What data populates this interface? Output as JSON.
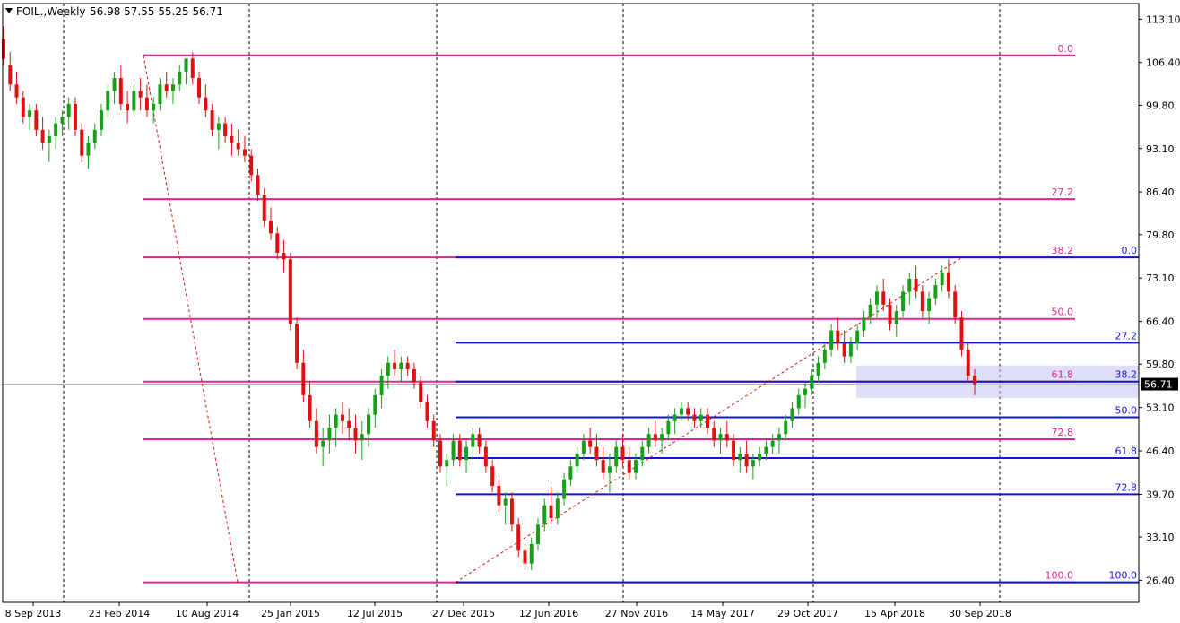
{
  "header": {
    "symbol_timeframe": "FOIL.,Weekly",
    "ohlc": "56.98 57.55 55.25 56.71",
    "collapse_glyph": "triangle-down-icon"
  },
  "colors": {
    "pink": "#e8228c",
    "blue": "#1414d2",
    "bull": "#16a016",
    "bear": "#e01010",
    "grid": "#000000",
    "price_tag_bg": "#000000",
    "zone": "#c8c8f0"
  },
  "chart_data": {
    "type": "candlestick",
    "title": "FOIL.,Weekly",
    "ylim": [
      23.0,
      115.5
    ],
    "y_ticks": [
      "113.10",
      "106.40",
      "99.80",
      "93.10",
      "86.40",
      "79.80",
      "73.10",
      "66.40",
      "59.80",
      "53.10",
      "46.40",
      "39.70",
      "33.10",
      "26.40"
    ],
    "x_ticks": [
      "8 Sep 2013",
      "23 Feb 2014",
      "10 Aug 2014",
      "25 Jan 2015",
      "12 Jul 2015",
      "27 Dec 2015",
      "12 Jun 2016",
      "27 Nov 2016",
      "14 May 2017",
      "29 Oct 2017",
      "15 Apr 2018",
      "30 Sep 2018"
    ],
    "current_price": "56.71",
    "series": [
      {
        "values": [
          [
            0,
            110,
            112,
            106,
            107
          ],
          [
            1,
            106,
            108,
            102,
            103
          ],
          [
            2,
            103,
            105,
            100,
            101
          ],
          [
            3,
            101,
            102,
            97,
            98
          ],
          [
            4,
            98,
            100,
            96,
            99
          ],
          [
            5,
            99,
            100,
            95,
            96
          ],
          [
            6,
            96,
            98,
            93,
            94
          ],
          [
            7,
            94,
            96,
            91,
            95
          ],
          [
            8,
            95,
            98,
            93,
            97
          ],
          [
            9,
            97,
            99,
            95,
            98
          ],
          [
            10,
            98,
            101,
            96,
            100
          ],
          [
            11,
            100,
            101,
            95,
            96
          ],
          [
            12,
            96,
            97,
            91,
            92
          ],
          [
            13,
            92,
            95,
            90,
            94
          ],
          [
            14,
            94,
            97,
            93,
            96
          ],
          [
            15,
            96,
            100,
            95,
            99
          ],
          [
            16,
            99,
            103,
            98,
            102
          ],
          [
            17,
            102,
            105,
            100,
            104
          ],
          [
            18,
            104,
            106,
            99,
            100
          ],
          [
            19,
            100,
            102,
            97,
            99
          ],
          [
            20,
            99,
            103,
            98,
            102
          ],
          [
            21,
            102,
            104,
            99,
            101
          ],
          [
            22,
            101,
            103,
            98,
            99
          ],
          [
            23,
            99,
            101,
            97,
            100
          ],
          [
            24,
            100,
            104,
            99,
            103
          ],
          [
            25,
            103,
            105,
            101,
            102
          ],
          [
            26,
            102,
            104,
            100,
            103
          ],
          [
            27,
            103,
            106,
            102,
            105
          ],
          [
            28,
            105,
            107,
            103,
            107
          ],
          [
            29,
            107,
            108,
            103,
            104
          ],
          [
            30,
            104,
            105,
            100,
            101
          ],
          [
            31,
            101,
            103,
            98,
            99
          ],
          [
            32,
            99,
            100,
            95,
            96
          ],
          [
            33,
            96,
            98,
            93,
            97
          ],
          [
            34,
            97,
            98,
            94,
            95
          ],
          [
            35,
            95,
            97,
            92,
            94
          ],
          [
            36,
            94,
            96,
            92,
            93
          ],
          [
            37,
            93,
            95,
            91,
            92
          ],
          [
            38,
            92,
            93,
            88,
            89
          ],
          [
            39,
            89,
            90,
            85,
            86
          ],
          [
            40,
            86,
            87,
            81,
            82
          ],
          [
            41,
            82,
            84,
            79,
            80
          ],
          [
            42,
            80,
            81,
            76,
            77
          ],
          [
            43,
            77,
            79,
            74,
            76
          ],
          [
            44,
            76,
            77,
            65,
            66
          ],
          [
            45,
            66,
            67,
            59,
            60
          ],
          [
            46,
            60,
            62,
            54,
            55
          ],
          [
            47,
            55,
            57,
            50,
            51
          ],
          [
            48,
            51,
            53,
            46,
            47
          ],
          [
            49,
            47,
            50,
            44,
            48
          ],
          [
            50,
            48,
            52,
            46,
            50
          ],
          [
            51,
            50,
            53,
            47,
            52
          ],
          [
            52,
            52,
            54,
            49,
            51
          ],
          [
            53,
            51,
            53,
            48,
            50
          ],
          [
            54,
            50,
            52,
            46,
            48
          ],
          [
            55,
            48,
            51,
            45,
            49
          ],
          [
            56,
            49,
            53,
            47,
            52
          ],
          [
            57,
            52,
            56,
            50,
            55
          ],
          [
            58,
            55,
            59,
            53,
            58
          ],
          [
            59,
            58,
            61,
            56,
            60
          ],
          [
            60,
            60,
            62,
            58,
            59
          ],
          [
            61,
            59,
            61,
            57,
            60
          ],
          [
            62,
            60,
            61,
            58,
            59
          ],
          [
            63,
            59,
            60,
            56,
            57
          ],
          [
            64,
            57,
            58,
            53,
            54
          ],
          [
            65,
            54,
            55,
            50,
            51
          ],
          [
            66,
            51,
            52,
            47,
            48
          ],
          [
            67,
            48,
            49,
            43,
            44
          ],
          [
            68,
            44,
            46,
            41,
            45
          ],
          [
            69,
            45,
            49,
            44,
            48
          ],
          [
            70,
            48,
            49,
            44,
            45
          ],
          [
            71,
            45,
            48,
            43,
            47
          ],
          [
            72,
            47,
            50,
            45,
            49
          ],
          [
            73,
            49,
            50,
            46,
            47
          ],
          [
            74,
            47,
            48,
            43,
            44
          ],
          [
            75,
            44,
            45,
            40,
            41
          ],
          [
            76,
            41,
            42,
            37,
            38
          ],
          [
            77,
            38,
            40,
            35,
            39
          ],
          [
            78,
            39,
            40,
            34,
            35
          ],
          [
            79,
            35,
            36,
            30,
            31
          ],
          [
            80,
            31,
            32,
            28,
            29
          ],
          [
            81,
            29,
            33,
            28,
            32
          ],
          [
            82,
            32,
            36,
            31,
            35
          ],
          [
            83,
            35,
            39,
            34,
            38
          ],
          [
            84,
            38,
            41,
            35,
            36
          ],
          [
            85,
            36,
            40,
            35,
            39
          ],
          [
            86,
            39,
            43,
            38,
            42
          ],
          [
            87,
            42,
            45,
            41,
            44
          ],
          [
            88,
            44,
            47,
            43,
            46
          ],
          [
            89,
            46,
            49,
            45,
            48
          ],
          [
            90,
            48,
            50,
            46,
            47
          ],
          [
            91,
            47,
            49,
            44,
            45
          ],
          [
            92,
            45,
            47,
            42,
            43
          ],
          [
            93,
            43,
            46,
            40,
            44
          ],
          [
            94,
            44,
            48,
            43,
            47
          ],
          [
            95,
            47,
            49,
            44,
            45
          ],
          [
            96,
            45,
            47,
            42,
            43
          ],
          [
            97,
            43,
            46,
            42,
            45
          ],
          [
            98,
            45,
            48,
            44,
            47
          ],
          [
            99,
            47,
            50,
            46,
            49
          ],
          [
            100,
            49,
            51,
            47,
            48
          ],
          [
            101,
            48,
            50,
            46,
            49
          ],
          [
            102,
            49,
            52,
            48,
            51
          ],
          [
            103,
            51,
            53,
            49,
            52
          ],
          [
            104,
            52,
            54,
            51,
            53
          ],
          [
            105,
            53,
            54,
            51,
            52
          ],
          [
            106,
            52,
            53,
            50,
            51
          ],
          [
            107,
            51,
            53,
            50,
            52
          ],
          [
            108,
            52,
            53,
            49,
            50
          ],
          [
            109,
            50,
            51,
            47,
            48
          ],
          [
            110,
            48,
            50,
            46,
            49
          ],
          [
            111,
            49,
            51,
            47,
            48
          ],
          [
            112,
            48,
            49,
            44,
            45
          ],
          [
            113,
            45,
            47,
            43,
            46
          ],
          [
            114,
            46,
            48,
            43,
            44
          ],
          [
            115,
            44,
            46,
            42,
            45
          ],
          [
            116,
            45,
            47,
            44,
            46
          ],
          [
            117,
            46,
            48,
            45,
            47
          ],
          [
            118,
            47,
            49,
            46,
            48
          ],
          [
            119,
            48,
            50,
            46,
            49
          ],
          [
            120,
            49,
            52,
            48,
            51
          ],
          [
            121,
            51,
            54,
            50,
            53
          ],
          [
            122,
            53,
            56,
            52,
            55
          ],
          [
            123,
            55,
            57,
            53,
            56
          ],
          [
            124,
            56,
            59,
            55,
            58
          ],
          [
            125,
            58,
            61,
            57,
            60
          ],
          [
            126,
            60,
            63,
            59,
            62
          ],
          [
            127,
            62,
            66,
            61,
            65
          ],
          [
            128,
            65,
            67,
            62,
            63
          ],
          [
            129,
            63,
            65,
            60,
            61
          ],
          [
            130,
            61,
            64,
            60,
            63
          ],
          [
            131,
            63,
            66,
            62,
            65
          ],
          [
            132,
            65,
            68,
            64,
            67
          ],
          [
            133,
            67,
            70,
            66,
            69
          ],
          [
            134,
            69,
            72,
            67,
            71
          ],
          [
            135,
            71,
            73,
            68,
            69
          ],
          [
            136,
            69,
            70,
            65,
            66
          ],
          [
            137,
            66,
            69,
            64,
            68
          ],
          [
            138,
            68,
            72,
            67,
            71
          ],
          [
            139,
            71,
            74,
            69,
            73
          ],
          [
            140,
            73,
            75,
            70,
            71
          ],
          [
            141,
            71,
            72,
            67,
            68
          ],
          [
            142,
            68,
            71,
            66,
            70
          ],
          [
            143,
            70,
            73,
            69,
            72
          ],
          [
            144,
            72,
            75,
            71,
            74
          ],
          [
            145,
            74,
            76,
            70,
            71
          ],
          [
            146,
            71,
            72,
            66,
            67
          ],
          [
            147,
            67,
            68,
            61,
            62
          ],
          [
            148,
            62,
            63,
            57,
            58
          ],
          [
            149,
            58,
            59,
            55,
            56.71
          ]
        ]
      }
    ],
    "fibonacci_sets": [
      {
        "name": "pink",
        "levels": [
          {
            "label": "0.0",
            "price": 107.5
          },
          {
            "label": "27.2",
            "price": 85.3
          },
          {
            "label": "38.2",
            "price": 76.3
          },
          {
            "label": "50.0",
            "price": 66.8
          },
          {
            "label": "61.8",
            "price": 57.1
          },
          {
            "label": "72.8",
            "price": 48.2
          },
          {
            "label": "100.0",
            "price": 26.1
          }
        ]
      },
      {
        "name": "blue",
        "levels": [
          {
            "label": "0.0",
            "price": 76.3
          },
          {
            "label": "27.2",
            "price": 63.1
          },
          {
            "label": "38.2",
            "price": 57.1
          },
          {
            "label": "50.0",
            "price": 51.6
          },
          {
            "label": "61.8",
            "price": 45.3
          },
          {
            "label": "72.8",
            "price": 39.7
          },
          {
            "label": "100.0",
            "price": 26.1
          }
        ]
      }
    ]
  }
}
